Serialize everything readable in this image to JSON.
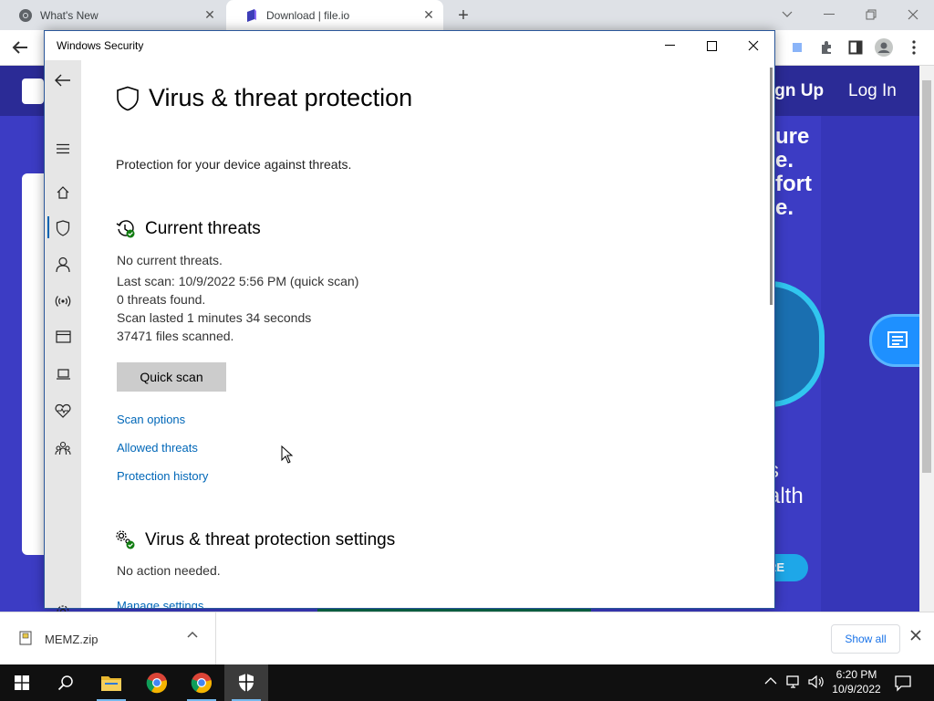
{
  "browser": {
    "tabs": [
      {
        "label": "What's New",
        "active": false
      },
      {
        "label": "Download | file.io",
        "active": true
      }
    ]
  },
  "webpage": {
    "sign_up": "ign Up",
    "log_in": "Log In",
    "hero_lines": [
      "ure",
      "e.",
      "fort",
      "e."
    ],
    "hero_lines2": [
      "s",
      "alth"
    ],
    "cta": "RE"
  },
  "window": {
    "title": "Windows Security",
    "page_title": "Virus & threat protection",
    "page_subtitle": "Protection for your device against threats.",
    "current_threats": {
      "title": "Current threats",
      "status": "No current threats.",
      "last_scan": "Last scan: 10/9/2022 5:56 PM (quick scan)",
      "threats_found": "0 threats found.",
      "duration": "Scan lasted 1 minutes 34 seconds",
      "files_scanned": "37471 files scanned.",
      "quick_scan_button": "Quick scan",
      "links": [
        "Scan options",
        "Allowed threats",
        "Protection history"
      ]
    },
    "settings": {
      "title": "Virus & threat protection settings",
      "status": "No action needed.",
      "link": "Manage settings"
    },
    "nav_icons": [
      "back-icon",
      "menu-icon",
      "home-icon",
      "shield-icon",
      "account-icon",
      "firewall-icon",
      "app-browser-icon",
      "device-security-icon",
      "health-icon",
      "family-icon",
      "settings-icon"
    ]
  },
  "download_bar": {
    "file_name": "MEMZ.zip",
    "show_all": "Show all"
  },
  "taskbar": {
    "time": "6:20 PM",
    "date": "10/9/2022"
  },
  "colors": {
    "accent": "#0067b8",
    "nav_bg": "#e6e6e6",
    "site_bg": "#3c3cc4",
    "taskbar": "#101010"
  }
}
